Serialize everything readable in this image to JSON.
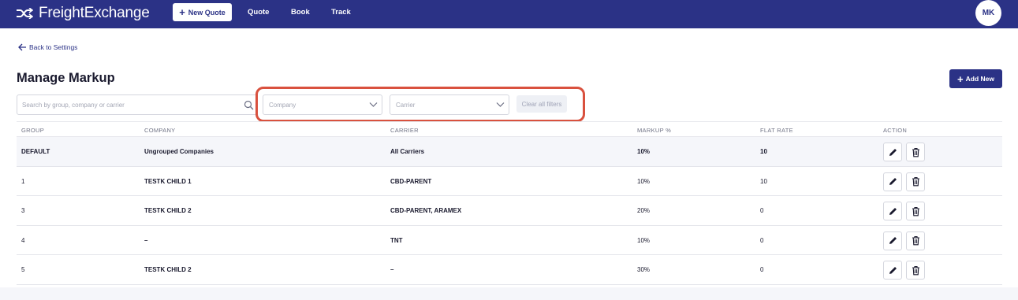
{
  "navbar": {
    "brand": "FreightExchange",
    "new_quote_label": "New Quote",
    "links": [
      "Quote",
      "Book",
      "Track"
    ],
    "avatar_initials": "MK"
  },
  "back_label": "Back to Settings",
  "page_title": "Manage Markup",
  "add_new_label": "Add New",
  "filters": {
    "search_placeholder": "Search by group, company or carrier",
    "company_placeholder": "Company",
    "carrier_placeholder": "Carrier",
    "clear_label": "Clear all filters"
  },
  "table": {
    "headers": [
      "GROUP",
      "COMPANY",
      "CARRIER",
      "MARKUP %",
      "FLAT RATE",
      "ACTION"
    ],
    "rows": [
      {
        "group": "DEFAULT",
        "company": "Ungrouped Companies",
        "carrier": "All Carriers",
        "markup": "10%",
        "flat_rate": "10"
      },
      {
        "group": "1",
        "company": "TESTK CHILD 1",
        "carrier": "CBD-PARENT",
        "markup": "10%",
        "flat_rate": "10"
      },
      {
        "group": "3",
        "company": "TESTK CHILD 2",
        "carrier": "CBD-PARENT, ARAMEX",
        "markup": "20%",
        "flat_rate": "0"
      },
      {
        "group": "4",
        "company": "–",
        "carrier": "TNT",
        "markup": "10%",
        "flat_rate": "0"
      },
      {
        "group": "5",
        "company": "TESTK CHILD 2",
        "carrier": "–",
        "markup": "30%",
        "flat_rate": "0"
      }
    ]
  },
  "colors": {
    "brand": "#2b3286",
    "highlight": "#d9513e"
  }
}
